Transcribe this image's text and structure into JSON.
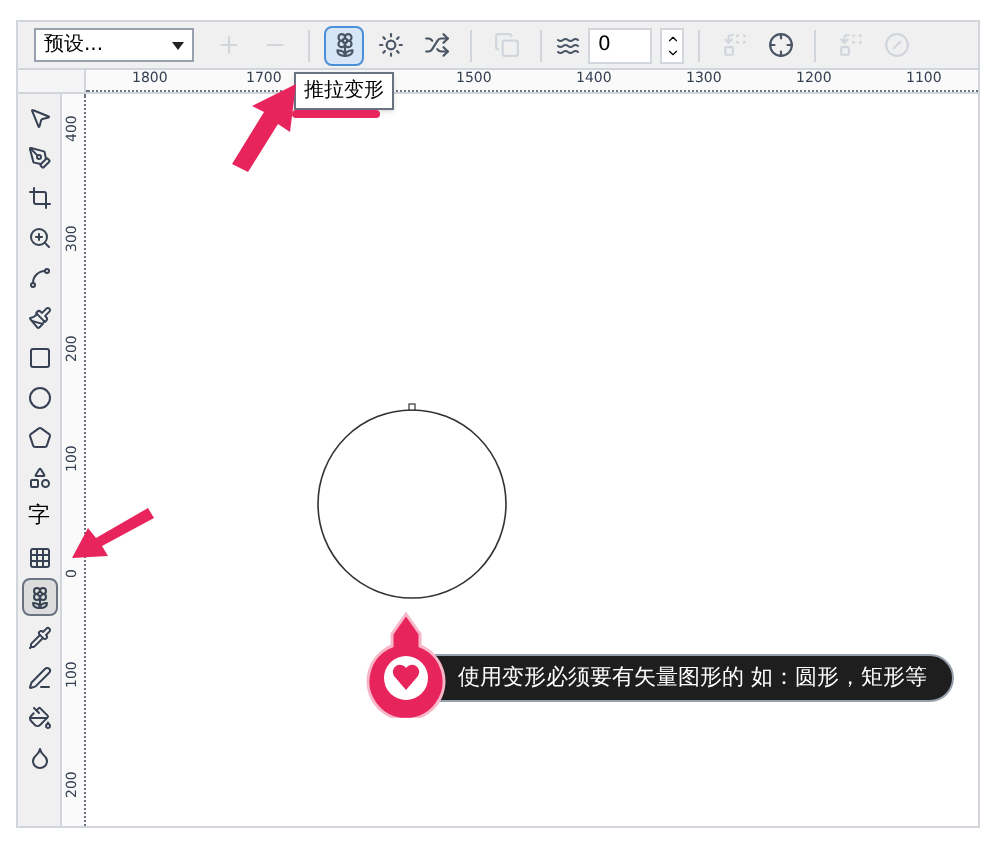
{
  "toolbar": {
    "preset_dropdown": {
      "value": "预设..."
    },
    "items": [
      {
        "kind": "add",
        "disabled": true,
        "selected": false
      },
      {
        "kind": "remove",
        "disabled": true,
        "selected": false
      },
      {
        "kind": "separator"
      },
      {
        "kind": "push_pull",
        "disabled": false,
        "selected": true
      },
      {
        "kind": "zipper",
        "disabled": false,
        "selected": false
      },
      {
        "kind": "twister",
        "disabled": false,
        "selected": false
      },
      {
        "kind": "separator"
      },
      {
        "kind": "copy",
        "disabled": true,
        "selected": false
      },
      {
        "kind": "separator"
      },
      {
        "kind": "amplitude",
        "value": "0"
      },
      {
        "kind": "separator"
      },
      {
        "kind": "clear",
        "disabled": true,
        "selected": false
      },
      {
        "kind": "center",
        "disabled": false,
        "selected": false
      },
      {
        "kind": "separator"
      },
      {
        "kind": "convert",
        "disabled": true,
        "selected": false
      },
      {
        "kind": "freeze",
        "disabled": true,
        "selected": false
      }
    ]
  },
  "tooltip": {
    "text": "推拉变形"
  },
  "horizontal_ruler": {
    "labels": [
      "1800",
      "1700",
      "1500",
      "1400",
      "1300",
      "1200",
      "1100"
    ]
  },
  "vertical_ruler": {
    "labels": [
      "400",
      "300",
      "200",
      "100",
      "0",
      "100",
      "200"
    ]
  },
  "toolbox": {
    "tools": [
      {
        "kind": "pick",
        "selected": false
      },
      {
        "kind": "shape",
        "selected": false
      },
      {
        "kind": "crop",
        "selected": false
      },
      {
        "kind": "zoom",
        "selected": false
      },
      {
        "kind": "freehand",
        "selected": false
      },
      {
        "kind": "smart_fill",
        "selected": false
      },
      {
        "kind": "rectangle",
        "selected": false
      },
      {
        "kind": "ellipse",
        "selected": false
      },
      {
        "kind": "polygon",
        "selected": false
      },
      {
        "kind": "basic_shapes",
        "selected": false
      },
      {
        "kind": "text",
        "label": "字",
        "selected": false
      },
      {
        "kind": "table",
        "selected": false
      },
      {
        "kind": "distort",
        "selected": true
      },
      {
        "kind": "eyedropper",
        "selected": false
      },
      {
        "kind": "outline",
        "selected": false
      },
      {
        "kind": "fill",
        "selected": false
      },
      {
        "kind": "interactive_fill",
        "selected": false
      }
    ]
  },
  "callout": {
    "text": "使用变形必须要有矢量图形的 如：圆形，矩形等"
  }
}
